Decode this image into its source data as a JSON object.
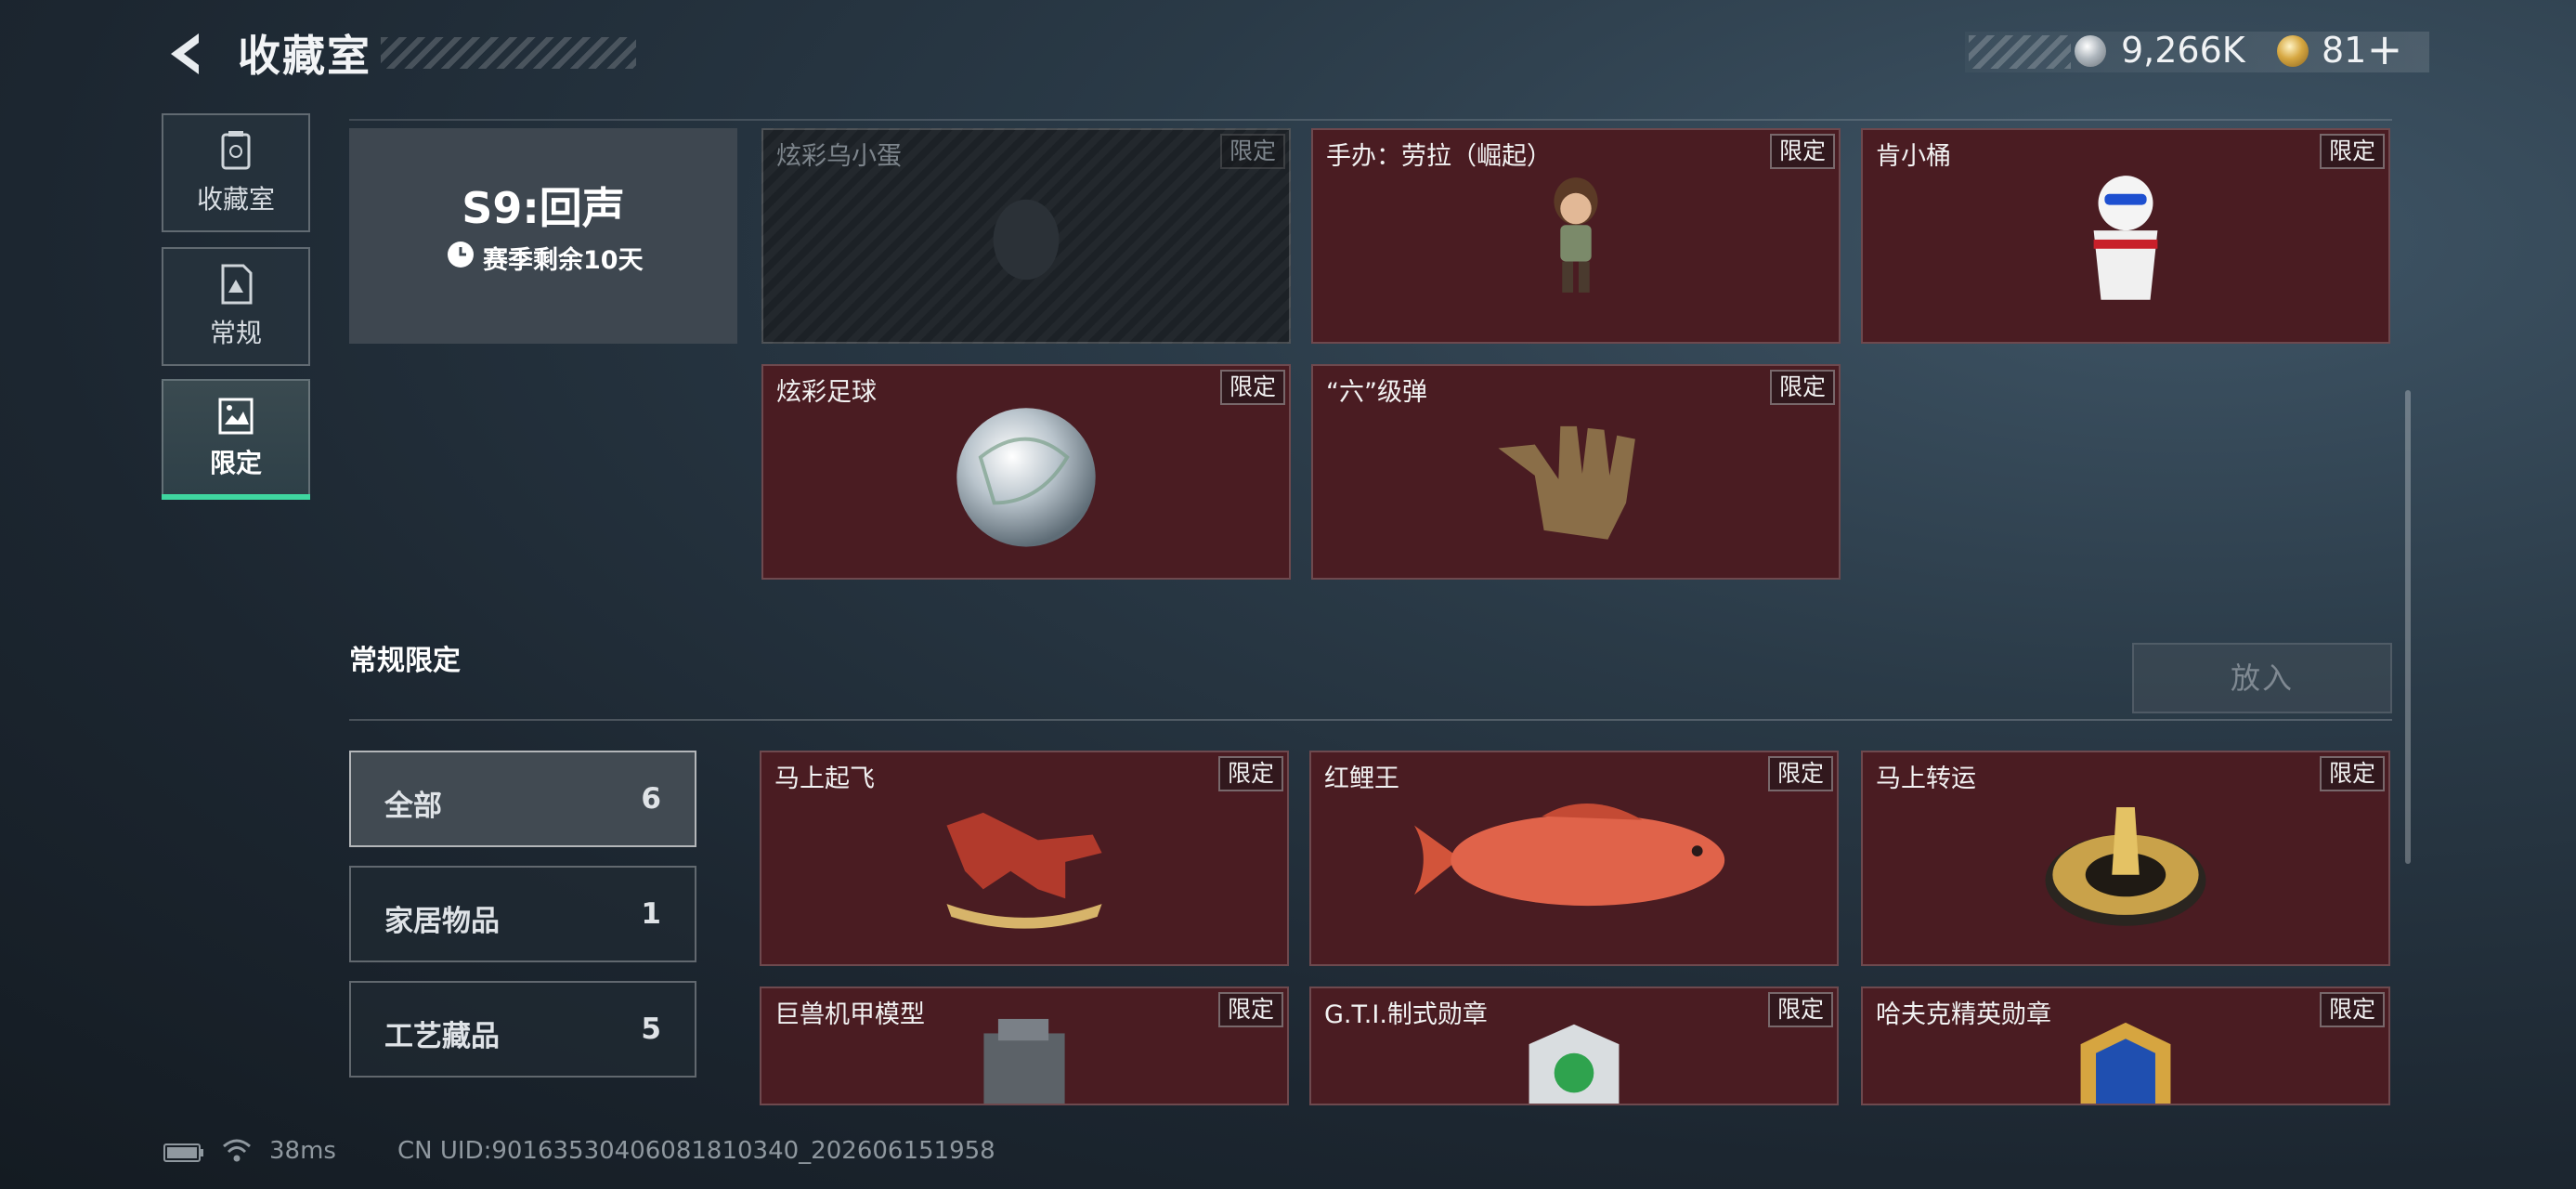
{
  "header": {
    "title": "收藏室",
    "silver_amount": "9,266K",
    "gold_amount": "81",
    "plus_label": "+"
  },
  "sidebar": {
    "items": [
      {
        "label": "收藏室",
        "icon": "trash-can-icon"
      },
      {
        "label": "常规",
        "icon": "document-icon"
      },
      {
        "label": "限定",
        "icon": "landscape-icon",
        "active": true
      }
    ]
  },
  "season": {
    "title": "S9:回声",
    "remaining": "赛季剩余10天"
  },
  "season_items": [
    {
      "name": "炫彩乌小蛋",
      "badge": "限定",
      "locked": true
    },
    {
      "name": "手办：劳拉（崛起）",
      "badge": "限定",
      "locked": false
    },
    {
      "name": "肯小桶",
      "badge": "限定",
      "locked": false
    },
    {
      "name": "炫彩足球",
      "badge": "限定",
      "locked": false
    },
    {
      "name": "“六”级弹",
      "badge": "限定",
      "locked": false
    }
  ],
  "regular_section": {
    "title": "常规限定",
    "put_button": "放入",
    "filters": [
      {
        "label": "全部",
        "count": "6",
        "active": true
      },
      {
        "label": "家居物品",
        "count": "1",
        "active": false
      },
      {
        "label": "工艺藏品",
        "count": "5",
        "active": false
      }
    ],
    "items": [
      {
        "name": "马上起飞",
        "badge": "限定"
      },
      {
        "name": "红鲤王",
        "badge": "限定"
      },
      {
        "name": "马上转运",
        "badge": "限定"
      },
      {
        "name": "巨兽机甲模型",
        "badge": "限定"
      },
      {
        "name": "G.T.I.制式勋章",
        "badge": "限定"
      },
      {
        "name": "哈夫克精英勋章",
        "badge": "限定"
      }
    ]
  },
  "footer": {
    "ping": "38ms",
    "uid": "CN UID:90163530406081810340_202606151958"
  },
  "colors": {
    "accent": "#3fd6a0",
    "card_bg": "#4a1c22"
  }
}
